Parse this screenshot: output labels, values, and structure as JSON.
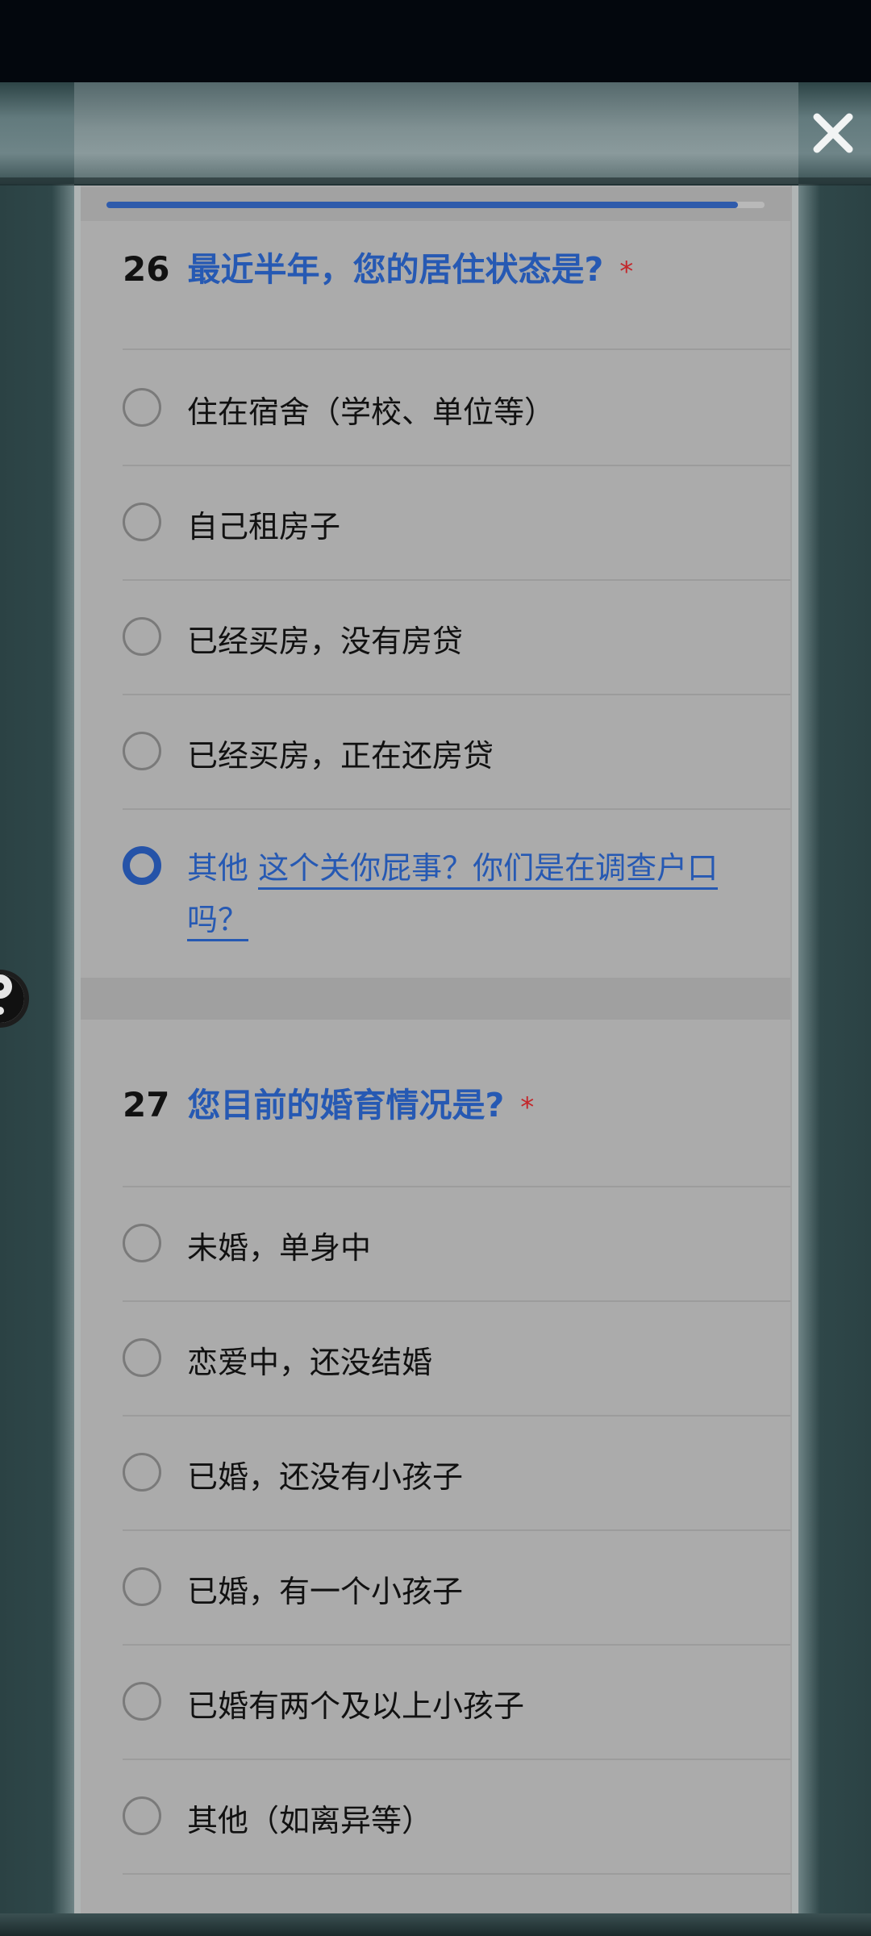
{
  "close_icon": "close-icon",
  "progress": {
    "fraction": 0.96
  },
  "questions": [
    {
      "number": "26",
      "title": "最近半年，您的居住状态是?",
      "required_mark": "*",
      "options": [
        {
          "label": "住在宿舍（学校、单位等）",
          "checked": false
        },
        {
          "label": "自己租房子",
          "checked": false
        },
        {
          "label": "已经买房，没有房贷",
          "checked": false
        },
        {
          "label": "已经买房，正在还房贷",
          "checked": false
        },
        {
          "label": "其他",
          "checked": true,
          "other_input": "这个关你屁事？你们是在调查户口吗？"
        }
      ]
    },
    {
      "number": "27",
      "title": "您目前的婚育情况是?",
      "required_mark": "*",
      "options": [
        {
          "label": "未婚，单身中",
          "checked": false
        },
        {
          "label": "恋爱中，还没结婚",
          "checked": false
        },
        {
          "label": "已婚，还没有小孩子",
          "checked": false
        },
        {
          "label": "已婚，有一个小孩子",
          "checked": false
        },
        {
          "label": "已婚有两个及以上小孩子",
          "checked": false
        },
        {
          "label": "其他（如离异等）",
          "checked": false
        }
      ]
    }
  ],
  "colors": {
    "accent": "#2659b3",
    "required": "#c3272b",
    "card": "#ababab",
    "frame": "#2d4446"
  }
}
